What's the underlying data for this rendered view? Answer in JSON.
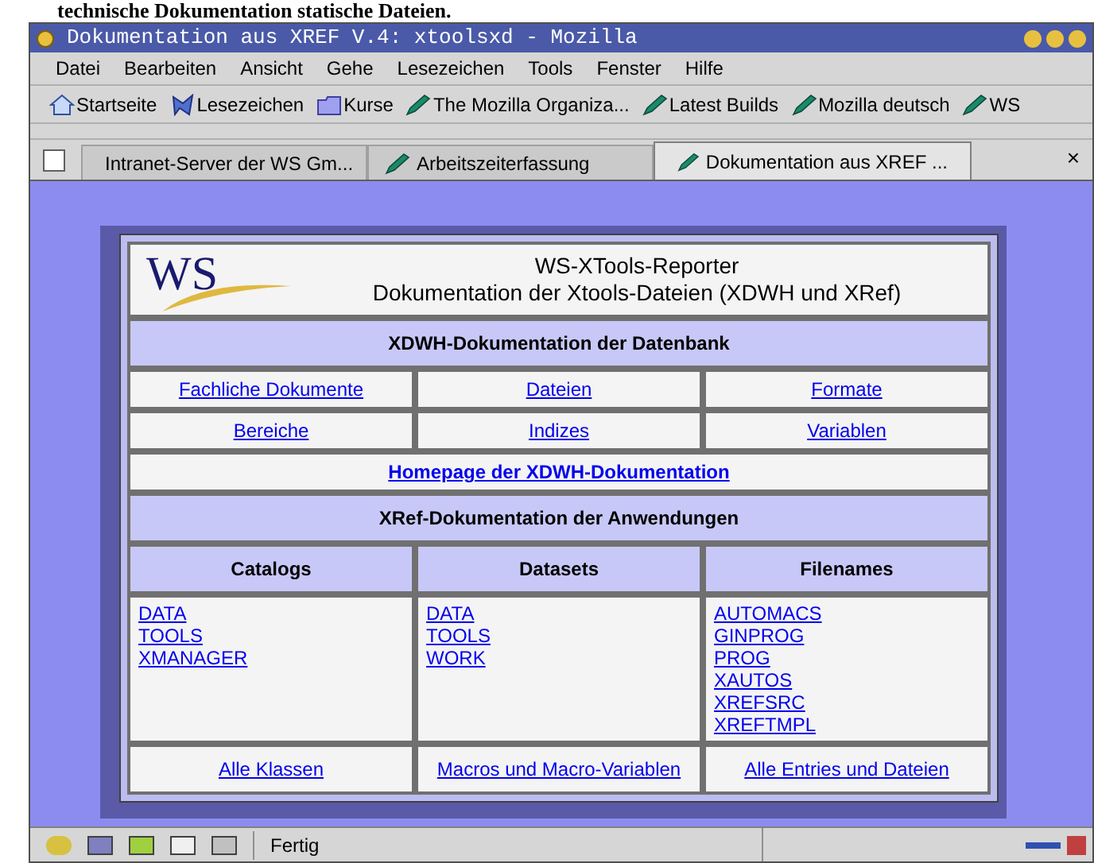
{
  "caption": "technische Dokumentation statische Dateien.",
  "window": {
    "title": "Dokumentation aus XREF V.4: xtoolsxd - Mozilla"
  },
  "menu": [
    "Datei",
    "Bearbeiten",
    "Ansicht",
    "Gehe",
    "Lesezeichen",
    "Tools",
    "Fenster",
    "Hilfe"
  ],
  "bookmarks": [
    {
      "label": "Startseite",
      "kind": "home"
    },
    {
      "label": "Lesezeichen",
      "kind": "bookmarks"
    },
    {
      "label": "Kurse",
      "kind": "folder"
    },
    {
      "label": "The Mozilla Organiza...",
      "kind": "link"
    },
    {
      "label": "Latest Builds",
      "kind": "link"
    },
    {
      "label": "Mozilla deutsch",
      "kind": "link"
    },
    {
      "label": "WS",
      "kind": "link"
    }
  ],
  "tabs": [
    {
      "label": "Intranet-Server der WS Gm...",
      "selected": false
    },
    {
      "label": "Arbeitszeiterfassung",
      "selected": false
    },
    {
      "label": "Dokumentation aus XREF ...",
      "selected": true
    }
  ],
  "tab_close": "×",
  "page": {
    "logo": "WS",
    "title": "WS-XTools-Reporter",
    "subtitle": "Dokumentation der Xtools-Dateien (XDWH und XRef)",
    "section_1": "XDWH-Dokumentation der Datenbank",
    "link_rows": [
      [
        "Fachliche Dokumente",
        "Dateien",
        "Formate"
      ],
      [
        "Bereiche",
        "Indizes",
        "Variablen"
      ]
    ],
    "homepage_link": "Homepage der XDWH-Dokumentation",
    "section_2": "XRef-Dokumentation der Anwendungen",
    "columns": [
      {
        "heading": "Catalogs",
        "links": [
          "DATA",
          "TOOLS",
          "XMANAGER"
        ]
      },
      {
        "heading": "Datasets",
        "links": [
          "DATA",
          "TOOLS",
          "WORK"
        ]
      },
      {
        "heading": "Filenames",
        "links": [
          "AUTOMACS",
          "GINPROG",
          "PROG",
          "XAUTOS",
          "XREFSRC",
          "XREFTMPL"
        ]
      }
    ],
    "footer_links": [
      "Alle Klassen",
      "Macros und Macro-Variablen",
      "Alle Entries und Dateien"
    ]
  },
  "status_bar": {
    "text": "Fertig"
  }
}
